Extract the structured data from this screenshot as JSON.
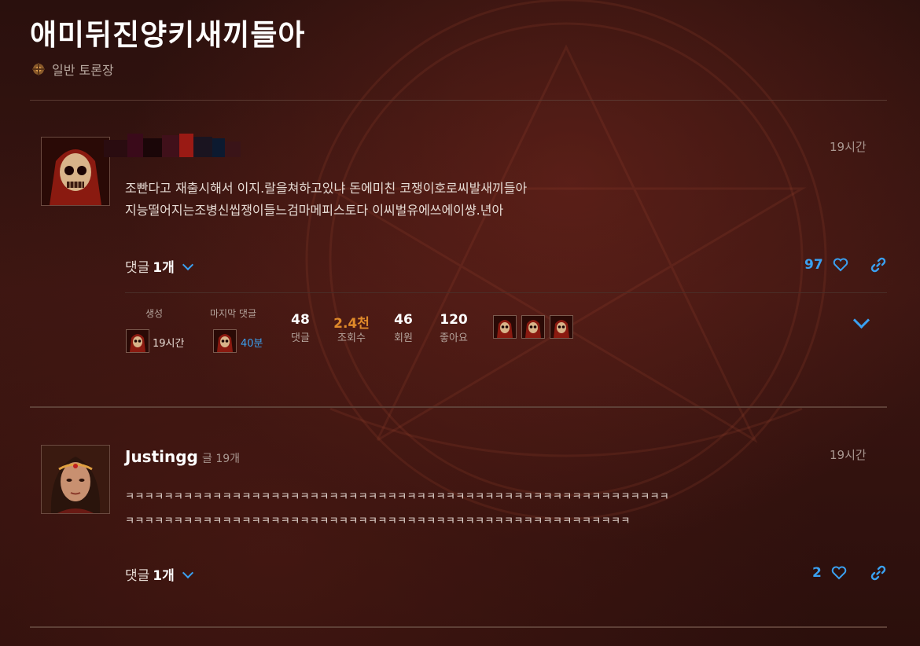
{
  "thread": {
    "title": "애미뒤진양키새끼들아",
    "category": "일반 토론장"
  },
  "posts": [
    {
      "time": "19시간",
      "lines": [
        "조빤다고 재출시해서 이지.랄을쳐하고있냐 돈에미친 코쟁이호로씨발새끼들아",
        "지능떨어지는조병신씹쟁이들느검마메피스토다 이씨벌유에쓰에이썅.년아"
      ],
      "reply_label": "댓글",
      "reply_count": "1개",
      "likes": "97"
    },
    {
      "name": "Justingg",
      "post_count": "글 19개",
      "time": "19시간",
      "lines": [
        "ㅋㅋㅋㅋㅋㅋㅋㅋㅋㅋㅋㅋㅋㅋㅋㅋㅋㅋㅋㅋㅋㅋㅋㅋㅋㅋㅋㅋㅋㅋㅋㅋㅋㅋㅋㅋㅋㅋㅋㅋㅋㅋㅋㅋㅋㅋㅋㅋㅋㅋㅋㅋㅋㅋㅋㅋ",
        "ㅋㅋㅋㅋㅋㅋㅋㅋㅋㅋㅋㅋㅋㅋㅋㅋㅋㅋㅋㅋㅋㅋㅋㅋㅋㅋㅋㅋㅋㅋㅋㅋㅋㅋㅋㅋㅋㅋㅋㅋㅋㅋㅋㅋㅋㅋㅋㅋㅋㅋㅋㅋ"
      ],
      "reply_label": "댓글",
      "reply_count": "1개",
      "likes": "2"
    }
  ],
  "stats": {
    "created_label": "생성",
    "created_time": "19시간",
    "last_reply_label": "마지막 댓글",
    "last_reply_time": "40분",
    "replies_num": "48",
    "replies_label": "댓글",
    "views_num": "2.4천",
    "views_label": "조회수",
    "users_num": "46",
    "users_label": "회원",
    "likes_num": "120",
    "likes_label": "좋아요"
  },
  "colors": {
    "accent": "#3aa0f0",
    "views_highlight": "#e08a2a"
  },
  "icons": [
    "heart-icon",
    "link-icon",
    "chevron-down-icon",
    "category-icon"
  ]
}
